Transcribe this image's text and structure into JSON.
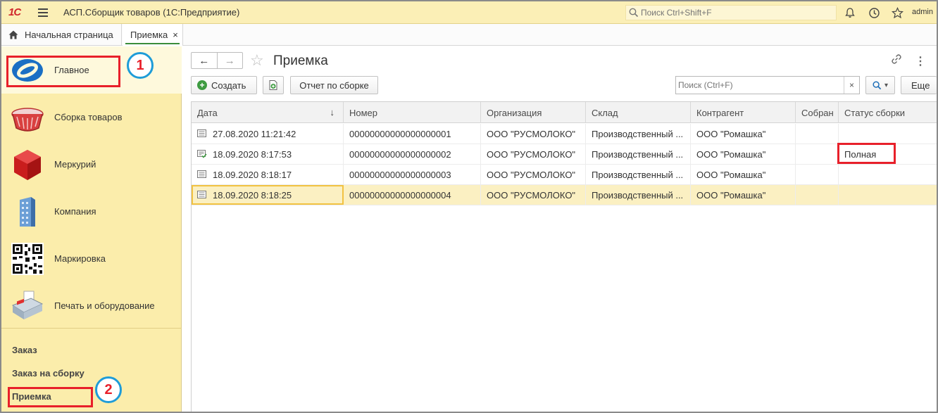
{
  "titlebar": {
    "logo": "1С",
    "title": "АСП.Сборщик товаров  (1С:Предприятие)",
    "search_placeholder": "Поиск Ctrl+Shift+F",
    "user": "admin"
  },
  "tabs": {
    "home_label": "Начальная страница",
    "active_label": "Приемка",
    "close_glyph": "×"
  },
  "sidebar": {
    "sections": [
      {
        "label": "Главное",
        "icon": "globe-icon"
      },
      {
        "label": "Сборка товаров",
        "icon": "basket-icon"
      },
      {
        "label": "Меркурий",
        "icon": "cube-icon"
      },
      {
        "label": "Компания",
        "icon": "building-icon"
      },
      {
        "label": "Маркировка",
        "icon": "qr-code-icon"
      },
      {
        "label": "Печать и оборудование",
        "icon": "cash-register-icon"
      }
    ],
    "nav": [
      "Заказ",
      "Заказ на сборку",
      "Приемка"
    ]
  },
  "badges": [
    "1",
    "2"
  ],
  "main": {
    "title": "Приемка",
    "back_glyph": "←",
    "forward_glyph": "→",
    "star_glyph": "☆",
    "more_glyph": "⋮",
    "create_label": "Создать",
    "report_label": "Отчет по сборке",
    "search_placeholder": "Поиск (Ctrl+F)",
    "clear_glyph": "×",
    "more_label": "Еще",
    "find_caret": "▾"
  },
  "table": {
    "columns": [
      "Дата",
      "Номер",
      "Организация",
      "Склад",
      "Контрагент",
      "Собран",
      "Статус сборки"
    ],
    "sort_glyph": "↓",
    "rows": [
      {
        "date": "27.08.2020 11:21:42",
        "number": "00000000000000000001",
        "org": "ООО \"РУСМОЛОКО\"",
        "warehouse": "Производственный ...",
        "counterparty": "ООО \"Ромашка\"",
        "collected": "",
        "status": "",
        "posted": false
      },
      {
        "date": "18.09.2020 8:17:53",
        "number": "00000000000000000002",
        "org": "ООО \"РУСМОЛОКО\"",
        "warehouse": "Производственный ...",
        "counterparty": "ООО \"Ромашка\"",
        "collected": "",
        "status": "Полная",
        "posted": true
      },
      {
        "date": "18.09.2020 8:18:17",
        "number": "00000000000000000003",
        "org": "ООО \"РУСМОЛОКО\"",
        "warehouse": "Производственный ...",
        "counterparty": "ООО \"Ромашка\"",
        "collected": "",
        "status": "",
        "posted": false
      },
      {
        "date": "18.09.2020 8:18:25",
        "number": "00000000000000000004",
        "org": "ООО \"РУСМОЛОКО\"",
        "warehouse": "Производственный ...",
        "counterparty": "ООО \"Ромашка\"",
        "collected": "",
        "status": "",
        "posted": false
      }
    ]
  },
  "colors": {
    "accent_yellow": "#fbedab",
    "highlight_red": "#e8202a",
    "badge_blue": "#1e9cd8",
    "create_green": "#3e9b41"
  }
}
